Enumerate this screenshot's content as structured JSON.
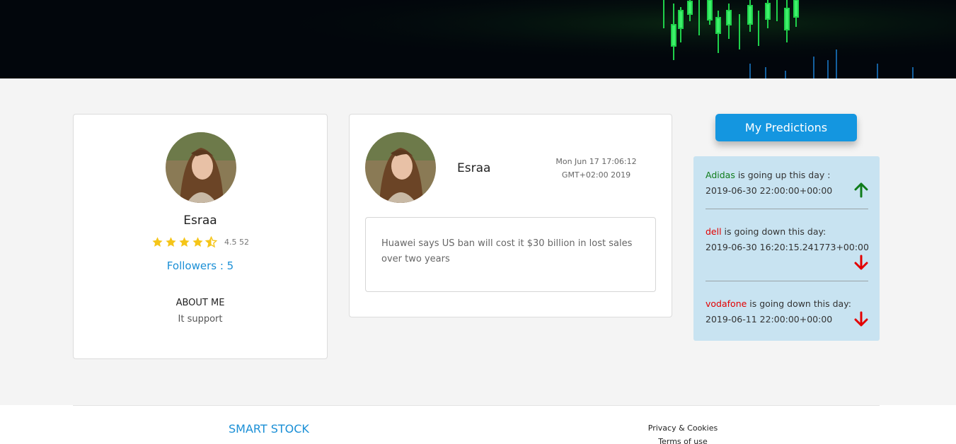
{
  "colors": {
    "accent": "#1496e0",
    "followers": "#1a8fd6",
    "up": "#0f7c1a",
    "down": "#e30000",
    "star": "#f5c518",
    "panel": "#c8e3f1"
  },
  "profile": {
    "name": "Esraa",
    "rating_stars": 4.5,
    "rating_text": "4.5 52",
    "followers": "Followers : 5",
    "about_title": "ABOUT ME",
    "about_text": "It support"
  },
  "post": {
    "author": "Esraa",
    "date": "Mon Jun 17 17:06:12 GMT+02:00 2019",
    "body": "Huawei says US ban will cost it $30 billion in lost sales over two years"
  },
  "predictions": {
    "button_label": "My Predictions",
    "items": [
      {
        "company": "Adidas",
        "direction": "up",
        "text": " is going up this day :",
        "date": "2019-06-30 22:00:00+00:00",
        "icon": "arrow-up-icon"
      },
      {
        "company": "dell",
        "direction": "down",
        "text": " is going down this day:",
        "date": "2019-06-30 16:20:15.241773+00:00",
        "icon": "arrow-down-icon"
      },
      {
        "company": "vodafone",
        "direction": "down",
        "text": " is going down this day:",
        "date": "2019-06-11 22:00:00+00:00",
        "icon": "arrow-down-icon"
      }
    ]
  },
  "footer": {
    "brand": "SMART STOCK",
    "links": [
      "Privacy & Cookies",
      "Terms of use"
    ]
  }
}
